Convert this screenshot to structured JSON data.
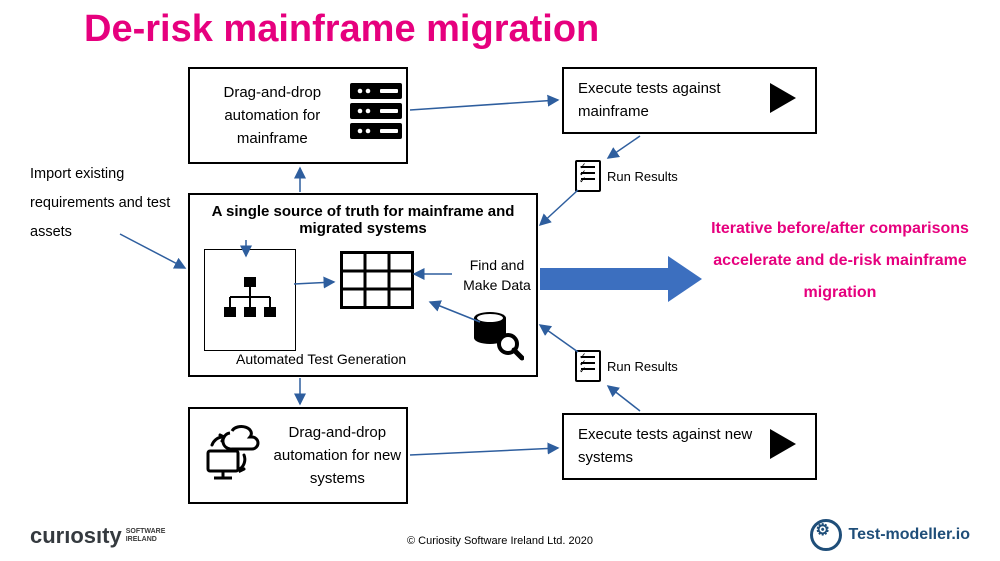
{
  "title": "De-risk mainframe migration",
  "import_text": "Import existing requirements and test assets",
  "callout": "Iterative before/after comparisons accelerate and de-risk mainframe migration",
  "boxes": {
    "top": "Drag-and-drop automation for mainframe",
    "bot": "Drag-and-drop automation for new systems",
    "exec1": "Execute tests against mainframe",
    "exec2": "Execute tests against new systems"
  },
  "mid": {
    "headline": "A single source of truth for mainframe and migrated systems",
    "atg": "Automated Test Generation",
    "find": "Find and Make Data"
  },
  "run_results": "Run Results",
  "footer": {
    "copyright": "© Curiosity Software Ireland Ltd. 2020",
    "curiosity": "curıosıty",
    "curiosity_tag": "SOFTWARE IRELAND",
    "testmodeller": "Test-modeller.io"
  }
}
